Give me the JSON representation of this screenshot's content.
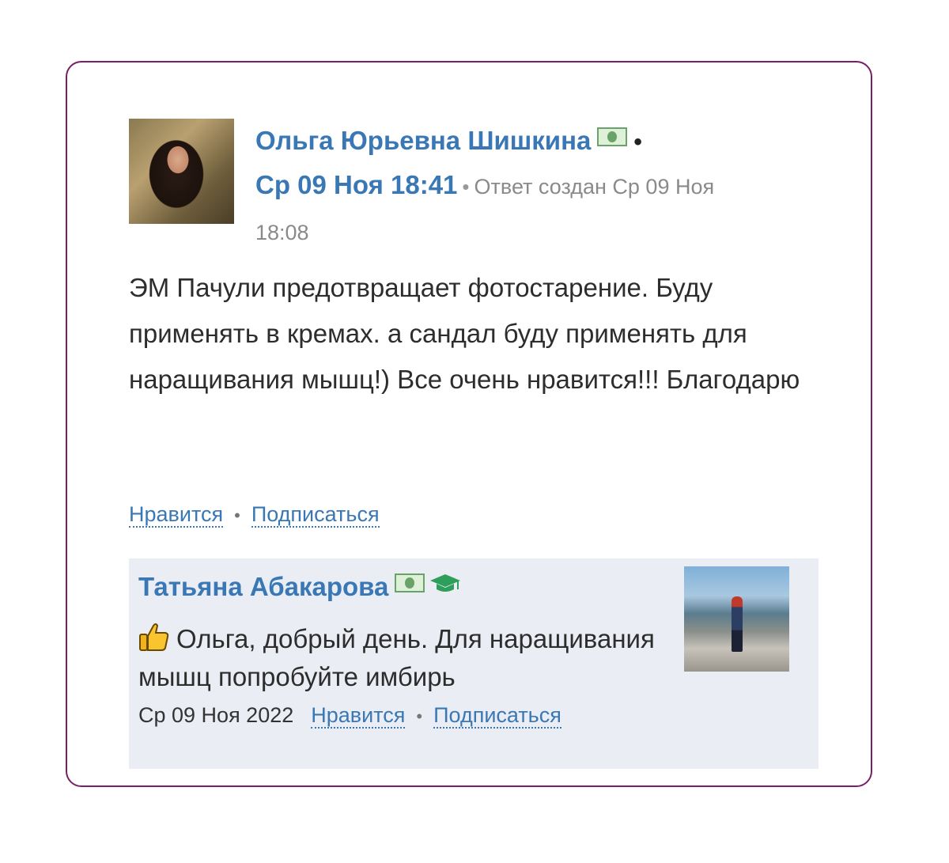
{
  "post": {
    "author_name": "Ольга Юрьевна Шишкина",
    "date_main": "Ср 09 Ноя 18:41",
    "created_label": "Ответ создан Ср 09 Ноя",
    "created_time": "18:08",
    "body": "ЭМ Пачули предотвращает фотостарение. Буду применять в кремах. а сандал буду применять для наращивания мышц!) Все очень нравится!!! Благодарю",
    "like_label": "Нравится",
    "subscribe_label": "Подписаться",
    "icons": [
      "money-icon"
    ]
  },
  "reply": {
    "author_name": "Татьяна Абакарова",
    "text": "Ольга, добрый день. Для наращивания мышц попробуйте имбирь",
    "date": "Ср 09 Ноя 2022",
    "like_label": "Нравится",
    "subscribe_label": "Подписаться",
    "icons": [
      "money-icon",
      "graduation-cap-icon",
      "thumbs-up-icon"
    ]
  },
  "colors": {
    "border": "#7a1f63",
    "link": "#3a78b5",
    "reply_bg": "#eaedf3",
    "money_green": "#6aa36a",
    "cap_green": "#2e9e5b"
  }
}
